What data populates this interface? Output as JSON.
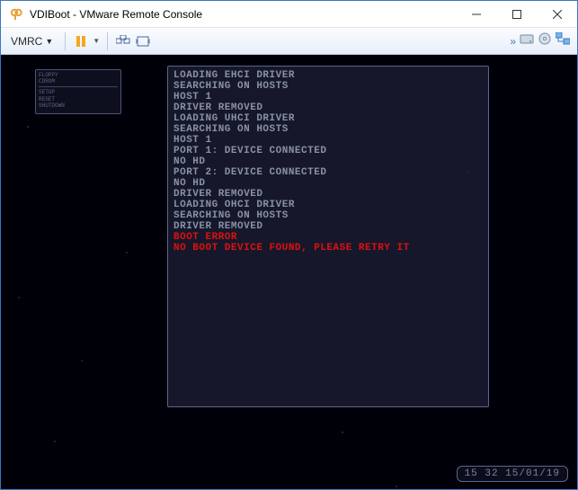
{
  "window": {
    "title": "VDIBoot - VMware Remote Console"
  },
  "toolbar": {
    "menu_label": "VMRC"
  },
  "small_panel": {
    "line1": "FLOPPY",
    "line2": "CDROM",
    "line3": "SETUP",
    "line4": "RESET",
    "line5": "SHUTDOWN"
  },
  "boot_lines": [
    {
      "text": "LOADING EHCI DRIVER",
      "err": false
    },
    {
      "text": "SEARCHING ON HOSTS",
      "err": false
    },
    {
      "text": "HOST 1",
      "err": false
    },
    {
      "text": "DRIVER REMOVED",
      "err": false
    },
    {
      "text": "LOADING UHCI DRIVER",
      "err": false
    },
    {
      "text": "SEARCHING ON HOSTS",
      "err": false
    },
    {
      "text": "HOST 1",
      "err": false
    },
    {
      "text": "PORT 1: DEVICE CONNECTED",
      "err": false
    },
    {
      "text": "NO HD",
      "err": false
    },
    {
      "text": "PORT 2: DEVICE CONNECTED",
      "err": false
    },
    {
      "text": "NO HD",
      "err": false
    },
    {
      "text": "DRIVER REMOVED",
      "err": false
    },
    {
      "text": "LOADING OHCI DRIVER",
      "err": false
    },
    {
      "text": "SEARCHING ON HOSTS",
      "err": false
    },
    {
      "text": "DRIVER REMOVED",
      "err": false
    },
    {
      "text": "BOOT ERROR",
      "err": true
    },
    {
      "text": "NO BOOT DEVICE FOUND, PLEASE RETRY IT",
      "err": true
    }
  ],
  "clock": {
    "text": "15 32 15/01/19"
  }
}
